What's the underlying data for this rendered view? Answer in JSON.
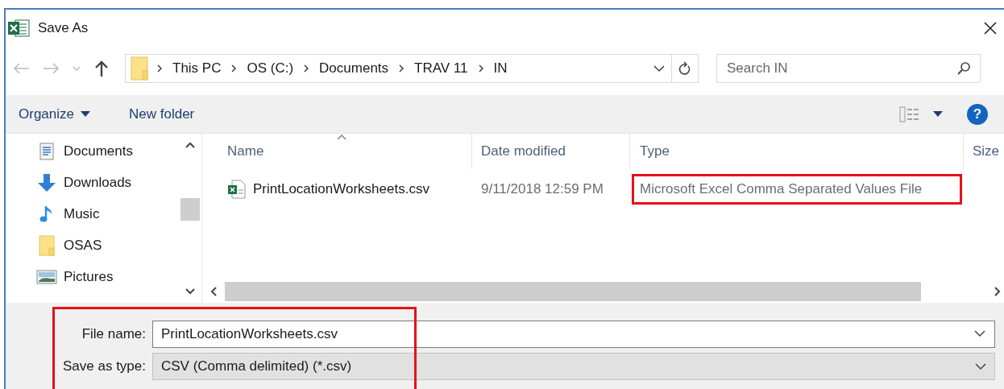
{
  "window": {
    "title": "Save As"
  },
  "address_bar": {
    "breadcrumb": [
      "This PC",
      "OS (C:)",
      "Documents",
      "TRAV 11",
      "IN"
    ]
  },
  "search": {
    "placeholder": "Search IN"
  },
  "toolbar": {
    "organize": "Organize",
    "new_folder": "New folder",
    "help": "?"
  },
  "sidebar": {
    "items": [
      {
        "label": "Documents",
        "kind": "documents"
      },
      {
        "label": "Downloads",
        "kind": "downloads"
      },
      {
        "label": "Music",
        "kind": "music"
      },
      {
        "label": "OSAS",
        "kind": "folder"
      },
      {
        "label": "Pictures",
        "kind": "pictures"
      }
    ]
  },
  "file_list": {
    "columns": [
      {
        "label": "Name",
        "sorted": true
      },
      {
        "label": "Date modified",
        "sorted": false
      },
      {
        "label": "Type",
        "sorted": false
      },
      {
        "label": "Size",
        "sorted": false
      }
    ],
    "rows": [
      {
        "name": "PrintLocationWorksheets.csv",
        "date_modified": "9/11/2018 12:59 PM",
        "type": "Microsoft Excel Comma Separated Values File",
        "type_highlighted": true
      }
    ]
  },
  "save_fields": {
    "highlighted": true,
    "file_name": {
      "label": "File name:",
      "value": "PrintLocationWorksheets.csv"
    },
    "save_as_type": {
      "label": "Save as type:",
      "value": "CSV (Comma delimited) (*.csv)"
    }
  }
}
